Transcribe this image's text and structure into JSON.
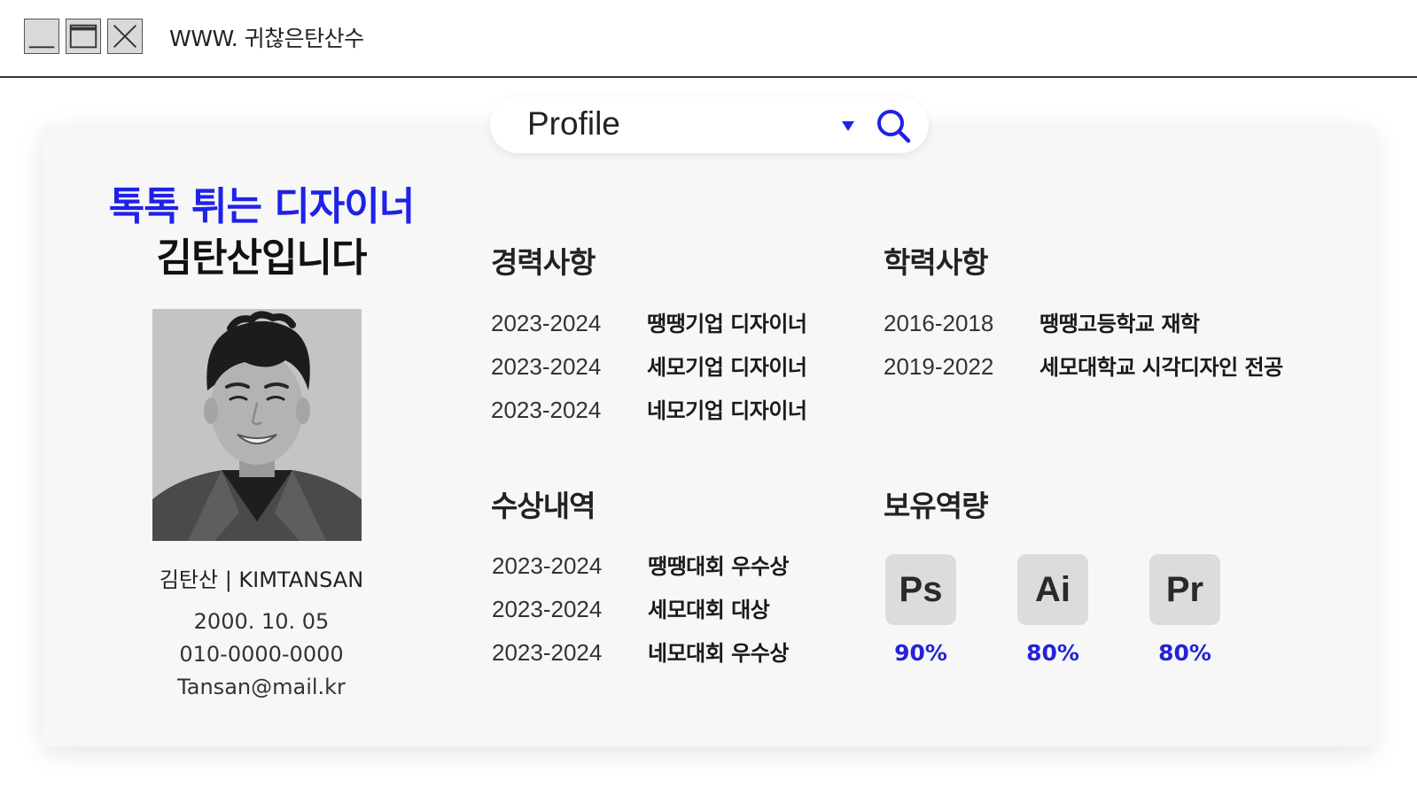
{
  "window": {
    "title": "WWW. 귀찮은탄산수",
    "buttons": [
      "minimize-icon",
      "maximize-icon",
      "close-icon"
    ]
  },
  "search": {
    "value": "Profile"
  },
  "headline": {
    "line1": "톡톡 튀는 디자이너",
    "line2": "김탄산입니다"
  },
  "person": {
    "name": "김탄산 | KIMTANSAN",
    "birth": "2000. 10. 05",
    "phone": "010-0000-0000",
    "email": "Tansan@mail.kr"
  },
  "career": {
    "title": "경력사항",
    "items": [
      {
        "year": "2023-2024",
        "text": "땡땡기업 디자이너"
      },
      {
        "year": "2023-2024",
        "text": "세모기업 디자이너"
      },
      {
        "year": "2023-2024",
        "text": "네모기업 디자이너"
      }
    ]
  },
  "education": {
    "title": "학력사항",
    "items": [
      {
        "year": "2016-2018",
        "text": "땡땡고등학교 재학"
      },
      {
        "year": "2019-2022",
        "text": "세모대학교 시각디자인 전공"
      }
    ]
  },
  "awards": {
    "title": "수상내역",
    "items": [
      {
        "year": "2023-2024",
        "text": "땡땡대회 우수상"
      },
      {
        "year": "2023-2024",
        "text": "세모대회 대상"
      },
      {
        "year": "2023-2024",
        "text": "네모대회 우수상"
      }
    ]
  },
  "skills": {
    "title": "보유역량",
    "items": [
      {
        "label": "Ps",
        "percent": "90%"
      },
      {
        "label": "Ai",
        "percent": "80%"
      },
      {
        "label": "Pr",
        "percent": "80%"
      }
    ]
  },
  "colors": {
    "accent": "#1f22e6",
    "card_bg": "#f7f7f7",
    "skill_box": "#dcdcdc"
  }
}
